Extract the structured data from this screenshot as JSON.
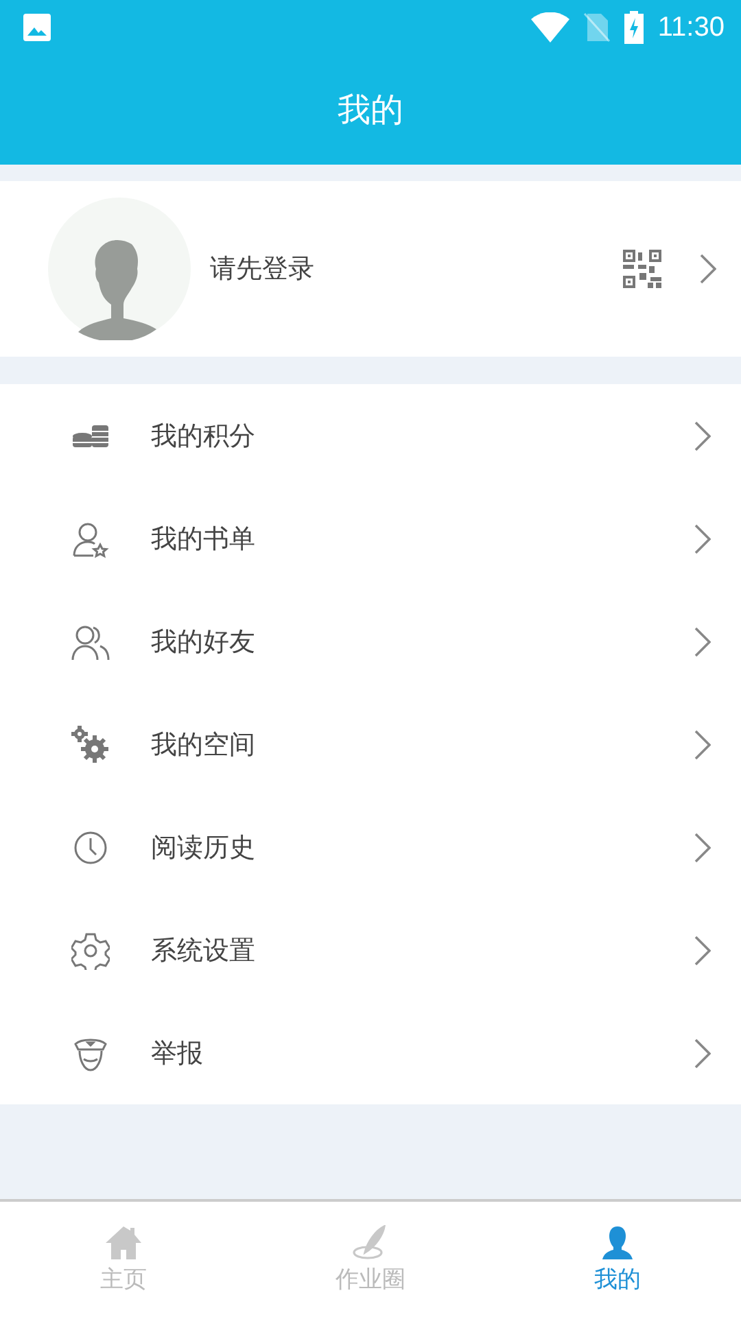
{
  "status_bar": {
    "time": "11:30"
  },
  "header": {
    "title": "我的"
  },
  "profile": {
    "login_prompt": "请先登录"
  },
  "menu": [
    {
      "kind": "coins",
      "label": "我的积分"
    },
    {
      "kind": "booklist",
      "label": "我的书单"
    },
    {
      "kind": "friends",
      "label": "我的好友"
    },
    {
      "kind": "gears",
      "label": "我的空间"
    },
    {
      "kind": "clock",
      "label": "阅读历史"
    },
    {
      "kind": "settings",
      "label": "系统设置"
    },
    {
      "kind": "officer",
      "label": "举报"
    }
  ],
  "tabs": [
    {
      "kind": "home",
      "label": "主页",
      "selected": false
    },
    {
      "kind": "quill",
      "label": "作业圈",
      "selected": false
    },
    {
      "kind": "person",
      "label": "我的",
      "selected": true
    }
  ]
}
